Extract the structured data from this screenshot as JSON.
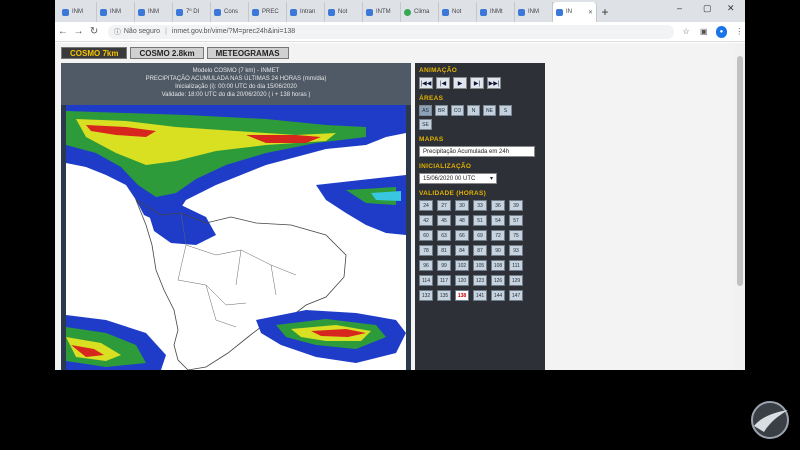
{
  "browser": {
    "tabs": [
      {
        "label": "INM"
      },
      {
        "label": "INM"
      },
      {
        "label": "INM"
      },
      {
        "label": "7º DI"
      },
      {
        "label": "Cons"
      },
      {
        "label": "PREC"
      },
      {
        "label": "Intran"
      },
      {
        "label": "Not"
      },
      {
        "label": "INTM"
      },
      {
        "label": "Clima"
      },
      {
        "label": "Not"
      },
      {
        "label": "INMt"
      },
      {
        "label": "INM"
      },
      {
        "label": "IN"
      }
    ],
    "new_tab": "+",
    "window_controls": {
      "minimize": "–",
      "maximize": "▢",
      "close": "✕"
    },
    "security_label": "Não seguro",
    "url": "inmet.gov.br/vime/?M=prec24h&ini=138"
  },
  "page": {
    "model_tabs": [
      {
        "label": "COSMO 7km",
        "active": true
      },
      {
        "label": "COSMO 2.8km",
        "active": false
      },
      {
        "label": "METEOGRAMAS",
        "active": false
      }
    ],
    "map": {
      "header_lines": [
        "Modelo COSMO (7 km) - INMET",
        "PRECIPITAÇÃO ACUMULADA NAS ÚLTIMAS 24 HORAS (mm/dia)",
        "Inicialização (i): 00:00 UTC do dia 15/06/2020",
        "Validade: 18:00 UTC do dia 20/06/2020 ( i + 138 horas )"
      ]
    },
    "controls": {
      "animation": {
        "title": "ANIMAÇÃO",
        "buttons": [
          "|◀◀",
          "|◀",
          "▶",
          "▶|",
          "▶▶|"
        ]
      },
      "areas": {
        "title": "ÁREAS",
        "buttons": [
          "AS",
          "BR",
          "CO",
          "N",
          "NE",
          "S",
          "SE"
        ]
      },
      "maps": {
        "title": "MAPAS",
        "selected": "Precipitação Acumulada em 24h"
      },
      "init": {
        "title": "INICIALIZAÇÃO",
        "selected": "15/06/2020 00 UTC"
      },
      "validity": {
        "title": "VALIDADE (HORAS)",
        "hours": [
          "24",
          "27",
          "30",
          "33",
          "36",
          "39",
          "42",
          "45",
          "48",
          "51",
          "54",
          "57",
          "60",
          "63",
          "66",
          "69",
          "72",
          "75",
          "78",
          "81",
          "84",
          "87",
          "90",
          "93",
          "96",
          "99",
          "102",
          "105",
          "108",
          "111",
          "114",
          "117",
          "120",
          "123",
          "126",
          "129",
          "132",
          "135",
          "138",
          "141",
          "144",
          "147"
        ],
        "selected": "138"
      }
    }
  },
  "colors": {
    "accent_yellow": "#e2b200",
    "panel_dark": "#2d3036",
    "active_tab_text": "#f5c400"
  }
}
